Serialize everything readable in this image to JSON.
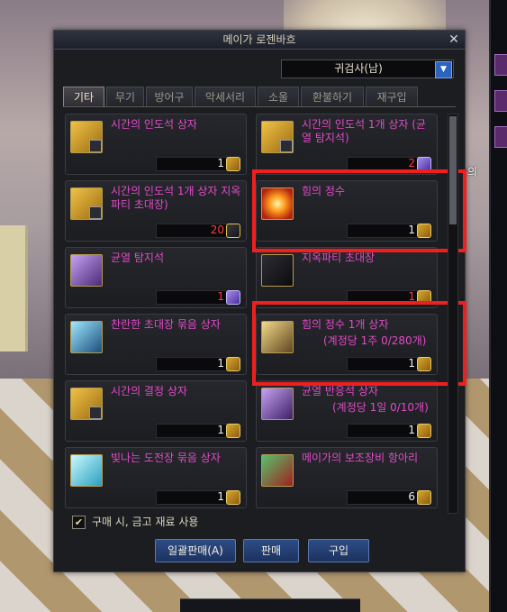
{
  "window": {
    "title": "메이가 로젠바흐",
    "close_icon": "close-icon",
    "class_select": "귀검사(남)"
  },
  "tabs": [
    {
      "label": "기타",
      "active": true
    },
    {
      "label": "무기",
      "active": false
    },
    {
      "label": "방어구",
      "active": false
    },
    {
      "label": "악세서리",
      "active": false
    },
    {
      "label": "소울",
      "active": false
    },
    {
      "label": "환불하기",
      "active": false
    },
    {
      "label": "재구입",
      "active": false
    }
  ],
  "items": [
    {
      "name": "시간의 인도석 상자",
      "qty": "1",
      "icon": "gold-chest-icon"
    },
    {
      "name": "시간의 인도석 1개 상자 (균열 탐지석)",
      "qty": "2",
      "qty_red": true,
      "icon": "gold-chest-icon"
    },
    {
      "name": "시간의 인도석 1개 상자 지옥 파티 초대장)",
      "qty": "20",
      "qty_red": true,
      "icon": "gold-chest-icon"
    },
    {
      "name": "힘의 정수",
      "qty": "1",
      "icon": "sun-orb-icon"
    },
    {
      "name": "균열 탐지석",
      "qty": "1",
      "qty_red": true,
      "icon": "crystal-icon"
    },
    {
      "name": "지옥파티 초대장",
      "qty": "1",
      "qty_red": true,
      "icon": "invitation-icon"
    },
    {
      "name": "찬란한 초대장 묶음 상자",
      "qty": "1",
      "icon": "blue-box-icon"
    },
    {
      "name": "힘의 정수 1개 상자",
      "limit": "(계정당 1주 0/280개)",
      "qty": "1",
      "icon": "limited-chest-icon"
    },
    {
      "name": "시간의 결정 상자",
      "qty": "1",
      "icon": "gold-chest-icon"
    },
    {
      "name": "균열 반응석 상자",
      "limit": "(계정당 1일 0/10개)",
      "qty": "1",
      "icon": "purple-chest-icon"
    },
    {
      "name": "빛나는 도전장 묶음 상자",
      "qty": "1",
      "icon": "cyan-box-icon"
    },
    {
      "name": "메이가의 보조장비 항아리",
      "qty": "6",
      "icon": "jar-icon"
    }
  ],
  "checkbox": {
    "checked": true,
    "label": "구매 시, 금고 재료 사용"
  },
  "buttons": {
    "bulk_sell": "일괄판매(A)",
    "sell": "판매",
    "buy": "구입"
  },
  "scene": {
    "status_text": "순의"
  }
}
